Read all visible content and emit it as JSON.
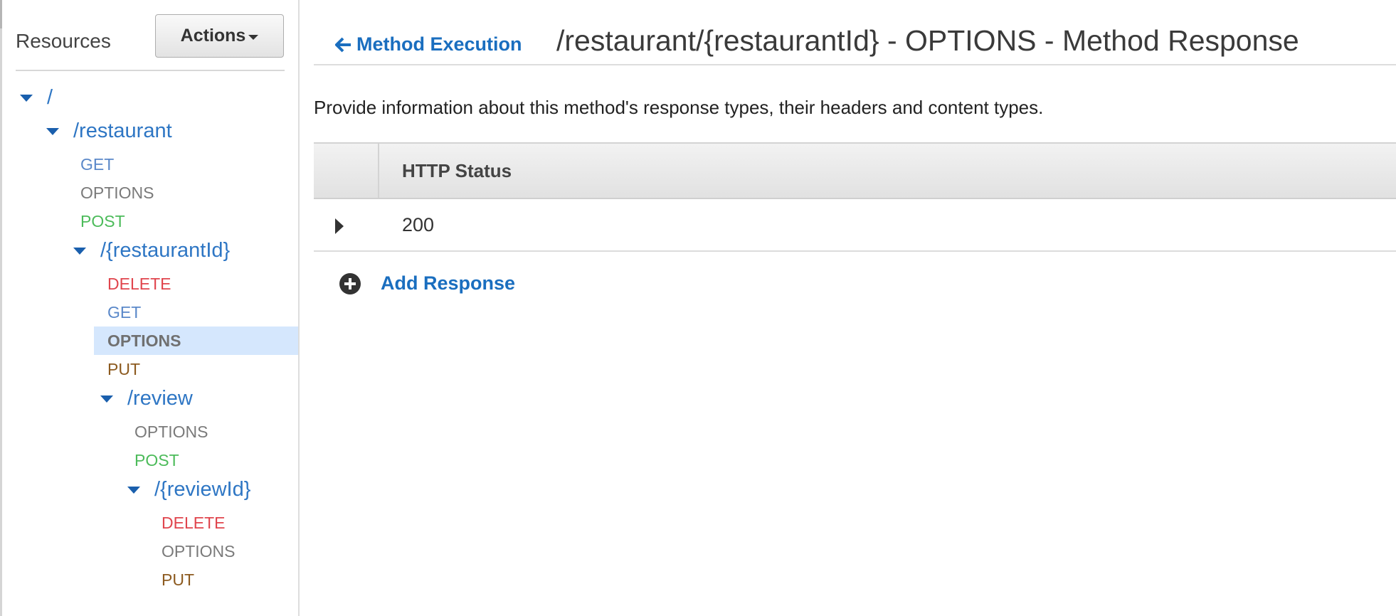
{
  "sidebar": {
    "title": "Resources",
    "actions_label": "Actions",
    "tree": {
      "root": {
        "path": "/",
        "restaurant": {
          "path": "/restaurant",
          "methods": [
            "GET",
            "OPTIONS",
            "POST"
          ],
          "restaurant_id": {
            "path": "/{restaurantId}",
            "methods": [
              "DELETE",
              "GET",
              "OPTIONS",
              "PUT"
            ],
            "selected_method": "OPTIONS",
            "review": {
              "path": "/review",
              "methods": [
                "OPTIONS",
                "POST"
              ],
              "review_id": {
                "path": "/{reviewId}",
                "methods": [
                  "DELETE",
                  "OPTIONS",
                  "PUT"
                ]
              }
            }
          }
        }
      }
    }
  },
  "main": {
    "back_label": "Method Execution",
    "title": "/restaurant/{restaurantId} - OPTIONS - Method Response",
    "description": "Provide information about this method's response types, their headers and content types.",
    "table": {
      "header": "HTTP Status",
      "rows": [
        {
          "status": "200"
        }
      ]
    },
    "add_response_label": "Add Response"
  },
  "colors": {
    "link_blue": "#1a6ebf",
    "resource_blue": "#2e76c4",
    "get": "#5a88c9",
    "options": "#7a7a7a",
    "post": "#4cbb5a",
    "delete": "#e0454d",
    "put": "#8c5a1f",
    "selected_bg": "#d5e7fd"
  },
  "icons": {
    "back": "arrow-left-icon",
    "add": "plus-circle-icon",
    "expand": "caret-right-icon",
    "tree_toggle": "caret-down-icon"
  }
}
